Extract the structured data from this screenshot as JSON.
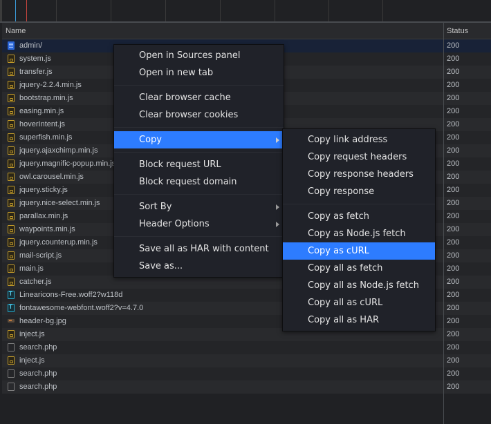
{
  "table": {
    "columns": {
      "name": "Name",
      "status": "Status"
    },
    "rows": [
      {
        "name": "admin/",
        "icon": "document-icon",
        "type": "doc",
        "status": "200",
        "selected": true
      },
      {
        "name": "system.js",
        "icon": "script-icon",
        "type": "js",
        "status": "200"
      },
      {
        "name": "transfer.js",
        "icon": "script-icon",
        "type": "js",
        "status": "200"
      },
      {
        "name": "jquery-2.2.4.min.js",
        "icon": "script-icon",
        "type": "js",
        "status": "200"
      },
      {
        "name": "bootstrap.min.js",
        "icon": "script-icon",
        "type": "js",
        "status": "200"
      },
      {
        "name": "easing.min.js",
        "icon": "script-icon",
        "type": "js",
        "status": "200"
      },
      {
        "name": "hoverIntent.js",
        "icon": "script-icon",
        "type": "js",
        "status": "200"
      },
      {
        "name": "superfish.min.js",
        "icon": "script-icon",
        "type": "js",
        "status": "200"
      },
      {
        "name": "jquery.ajaxchimp.min.js",
        "icon": "script-icon",
        "type": "js",
        "status": "200"
      },
      {
        "name": "jquery.magnific-popup.min.js",
        "icon": "script-icon",
        "type": "js",
        "status": "200"
      },
      {
        "name": "owl.carousel.min.js",
        "icon": "script-icon",
        "type": "js",
        "status": "200"
      },
      {
        "name": "jquery.sticky.js",
        "icon": "script-icon",
        "type": "js",
        "status": "200"
      },
      {
        "name": "jquery.nice-select.min.js",
        "icon": "script-icon",
        "type": "js",
        "status": "200"
      },
      {
        "name": "parallax.min.js",
        "icon": "script-icon",
        "type": "js",
        "status": "200"
      },
      {
        "name": "waypoints.min.js",
        "icon": "script-icon",
        "type": "js",
        "status": "200"
      },
      {
        "name": "jquery.counterup.min.js",
        "icon": "script-icon",
        "type": "js",
        "status": "200"
      },
      {
        "name": "mail-script.js",
        "icon": "script-icon",
        "type": "js",
        "status": "200"
      },
      {
        "name": "main.js",
        "icon": "script-icon",
        "type": "js",
        "status": "200"
      },
      {
        "name": "catcher.js",
        "icon": "script-icon",
        "type": "js",
        "status": "200"
      },
      {
        "name": "Linearicons-Free.woff2?w118d",
        "icon": "font-icon",
        "type": "font",
        "status": "200"
      },
      {
        "name": "fontawesome-webfont.woff2?v=4.7.0",
        "icon": "font-icon",
        "type": "font",
        "status": "200"
      },
      {
        "name": "header-bg.jpg",
        "icon": "image-icon",
        "type": "img",
        "status": "200"
      },
      {
        "name": "inject.js",
        "icon": "script-icon",
        "type": "js",
        "status": "200"
      },
      {
        "name": "search.php",
        "icon": "file-icon",
        "type": "other",
        "status": "200"
      },
      {
        "name": "inject.js",
        "icon": "script-icon",
        "type": "js",
        "status": "200"
      },
      {
        "name": "search.php",
        "icon": "file-icon",
        "type": "other",
        "status": "200"
      },
      {
        "name": "search.php",
        "icon": "file-icon",
        "type": "other",
        "status": "200"
      }
    ]
  },
  "overview": {
    "dom_content_loaded_color": "#3a9bd9",
    "load_color": "#d9534f"
  },
  "context_menu": {
    "groups": [
      [
        {
          "label": "Open in Sources panel"
        },
        {
          "label": "Open in new tab"
        }
      ],
      [
        {
          "label": "Clear browser cache"
        },
        {
          "label": "Clear browser cookies"
        }
      ],
      [
        {
          "label": "Copy",
          "submenu": true,
          "active": true
        }
      ],
      [
        {
          "label": "Block request URL"
        },
        {
          "label": "Block request domain"
        }
      ],
      [
        {
          "label": "Sort By",
          "submenu": true
        },
        {
          "label": "Header Options",
          "submenu": true
        }
      ],
      [
        {
          "label": "Save all as HAR with content"
        },
        {
          "label": "Save as..."
        }
      ]
    ]
  },
  "copy_submenu": {
    "groups": [
      [
        {
          "label": "Copy link address"
        },
        {
          "label": "Copy request headers"
        },
        {
          "label": "Copy response headers"
        },
        {
          "label": "Copy response"
        }
      ],
      [
        {
          "label": "Copy as fetch"
        },
        {
          "label": "Copy as Node.js fetch"
        },
        {
          "label": "Copy as cURL",
          "active": true
        },
        {
          "label": "Copy all as fetch"
        },
        {
          "label": "Copy all as Node.js fetch"
        },
        {
          "label": "Copy all as cURL"
        },
        {
          "label": "Copy all as HAR"
        }
      ]
    ]
  },
  "colors": {
    "accent": "#2d7cff",
    "selected_row": "#182237"
  }
}
